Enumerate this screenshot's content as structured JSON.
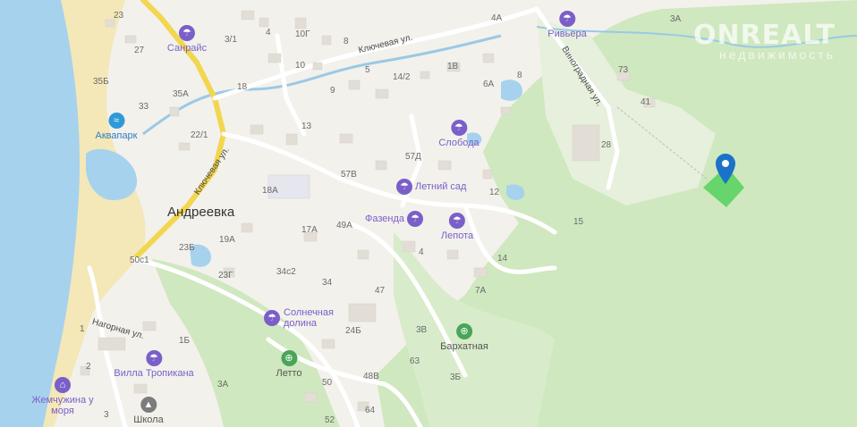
{
  "watermark": {
    "title": "ONREALT",
    "subtitle": "недвижимость"
  },
  "town": "Андреевка",
  "streets": {
    "klyuchevaya_top": "Ключевая ул.",
    "klyuchevaya_main": "Ключевая ул.",
    "vinogradnaya": "Виноградная ул.",
    "nagornaya": "Нагорная ул."
  },
  "pois": [
    {
      "name": "Санрайс",
      "kind": "hotel"
    },
    {
      "name": "Аквапарк",
      "kind": "water"
    },
    {
      "name": "Ривьера",
      "kind": "hotel"
    },
    {
      "name": "Слобода",
      "kind": "hotel"
    },
    {
      "name": "Летний сад",
      "kind": "hotel"
    },
    {
      "name": "Фазенда",
      "kind": "hotel"
    },
    {
      "name": "Лепота",
      "kind": "hotel"
    },
    {
      "name": "Солнечная долина",
      "kind": "hotel"
    },
    {
      "name": "Бархатная",
      "kind": "food"
    },
    {
      "name": "Летто",
      "kind": "food"
    },
    {
      "name": "Вилла Тропикана",
      "kind": "hotel"
    },
    {
      "name": "Жемчужина у моря",
      "kind": "hotel"
    },
    {
      "name": "Школа",
      "kind": "school"
    }
  ],
  "house_numbers": [
    "23",
    "27",
    "35Б",
    "33",
    "35А",
    "22/1",
    "3/1",
    "4",
    "10Г",
    "10",
    "8",
    "5",
    "18",
    "9",
    "13",
    "14/2",
    "1В",
    "4А",
    "6А",
    "8",
    "57Д",
    "57В",
    "18А",
    "19А",
    "17А",
    "49А",
    "23Б",
    "50с1",
    "23Г",
    "34с2",
    "34",
    "24Б",
    "47",
    "4",
    "14",
    "7А",
    "3В",
    "63",
    "3Б",
    "48В",
    "50",
    "64",
    "52",
    "3А",
    "1Б",
    "1",
    "2",
    "3",
    "12",
    "15",
    "41",
    "28",
    "73",
    "3А"
  ],
  "colors": {
    "accent": "#7a5fc9",
    "pin": "#1a73c8",
    "plot": "#5bd163",
    "sea": "#a6d2ed",
    "forest": "#cfe8bf"
  },
  "marker": {
    "name": "location-pin"
  }
}
